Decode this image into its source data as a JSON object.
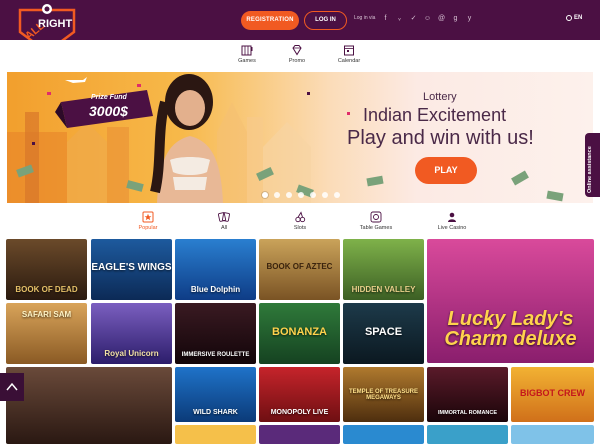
{
  "header": {
    "logo_text_top": "ALL",
    "logo_text_bottom": "RIGHT",
    "registration_label": "REGISTRATION",
    "login_label": "LOG IN",
    "login_via_label": "Log in via",
    "socials": [
      "facebook-icon",
      "vk-icon",
      "twitter-icon",
      "odnoklassniki-icon",
      "mailru-icon",
      "google-icon",
      "yandex-icon"
    ],
    "language_label": "EN"
  },
  "nav": {
    "items": [
      {
        "label": "Games",
        "icon": "slot-machine-icon"
      },
      {
        "label": "Promo",
        "icon": "diamond-icon"
      },
      {
        "label": "Calendar",
        "icon": "calendar-icon"
      }
    ]
  },
  "banner": {
    "prize_label": "Prize Fund",
    "prize_value": "3000$",
    "subtitle": "Lottery",
    "title": "Indian Excitement",
    "tagline": "Play and win with us!",
    "play_label": "PLAY",
    "slides_total": 7,
    "active_slide": 1
  },
  "assistance": {
    "label": "Online assistance"
  },
  "categories": [
    {
      "label": "Popular",
      "icon": "star-icon",
      "active": true
    },
    {
      "label": "All",
      "icon": "cards-icon",
      "active": false
    },
    {
      "label": "Slots",
      "icon": "cherries-icon",
      "active": false
    },
    {
      "label": "Table Games",
      "icon": "roulette-icon",
      "active": false
    },
    {
      "label": "Live Casino",
      "icon": "dealer-icon",
      "active": false
    }
  ],
  "games": [
    {
      "title": "BOOK OF DEAD"
    },
    {
      "title": "EAGLE'S WINGS"
    },
    {
      "title": "Blue Dolphin"
    },
    {
      "title": "BOOK OF AZTEC"
    },
    {
      "title": "HIDDEN VALLEY"
    },
    {
      "title": "Lucky Lady's Charm deluxe"
    },
    {
      "title": "SAFARI SAM"
    },
    {
      "title": "Royal Unicorn"
    },
    {
      "title": "IMMERSIVE ROULETTE"
    },
    {
      "title": "BONANZA"
    },
    {
      "title": "SPACE"
    },
    {
      "title": ""
    },
    {
      "title": "WILD SHARK"
    },
    {
      "title": "MONOPOLY LIVE"
    },
    {
      "title": "TEMPLE OF TREASURE MEGAWAYS"
    },
    {
      "title": "IMMORTAL ROMANCE"
    },
    {
      "title": "BIGBOT CREW"
    }
  ],
  "colors": {
    "brand_dark": "#4b1043",
    "accent": "#f15a22",
    "text_dark": "#4a2948"
  }
}
